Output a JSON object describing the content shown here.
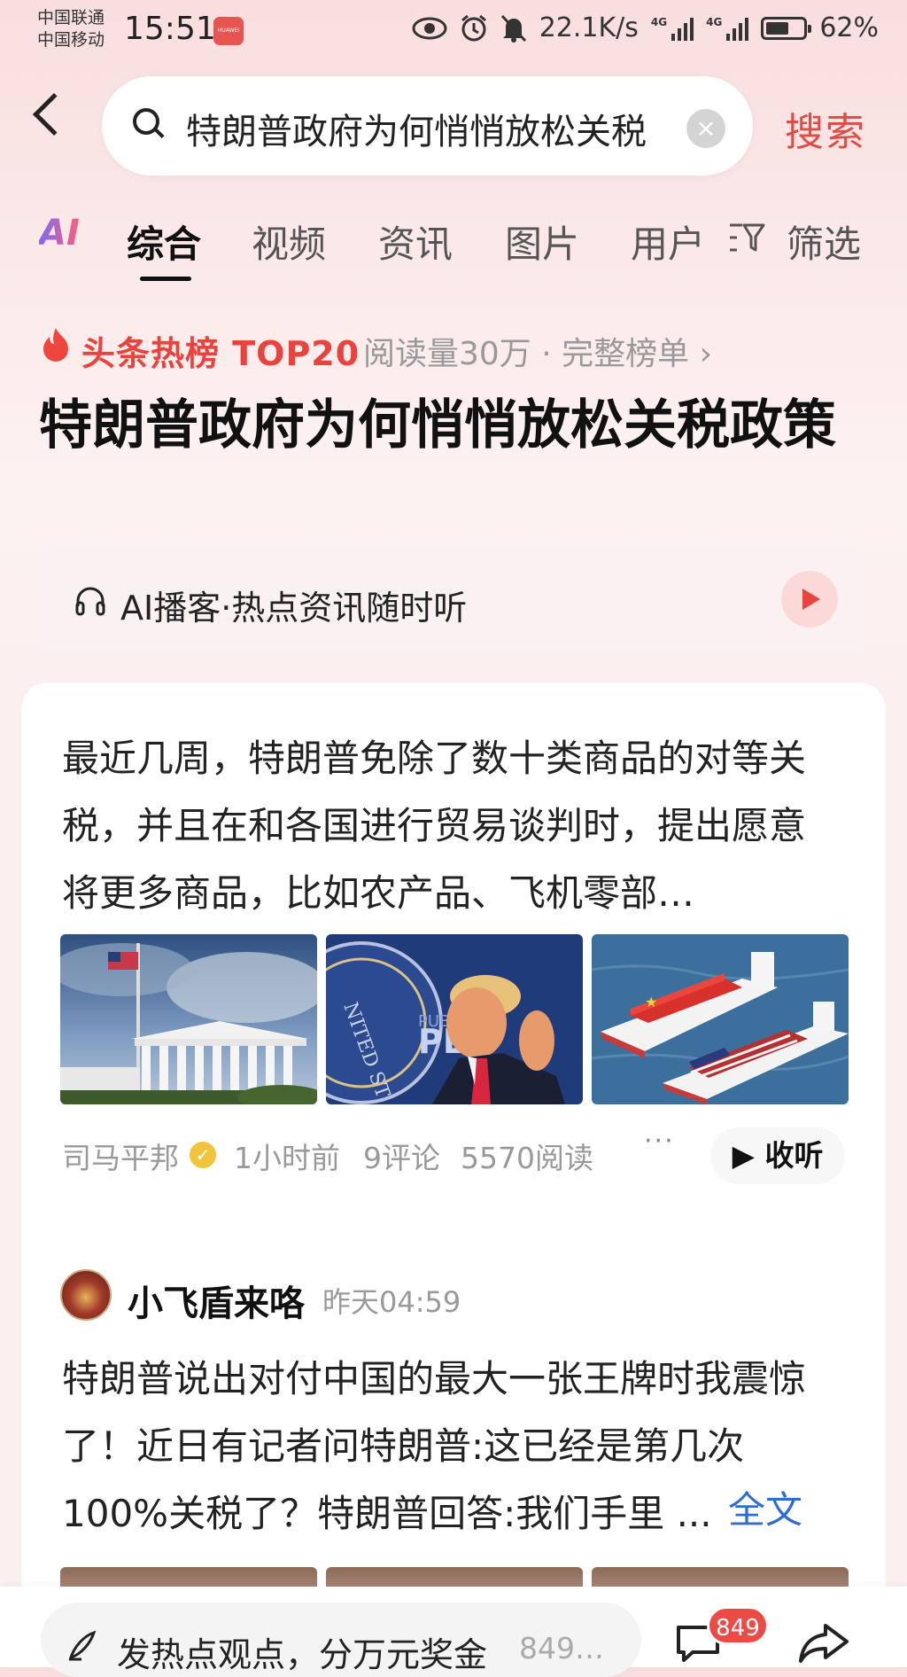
{
  "status_bar": {
    "carrier_1": "中国联通",
    "carrier_2": "中国移动",
    "time": "15:51",
    "app_badge": "HUAWEI",
    "net_speed": "22.1K/s",
    "sig1": "4G",
    "sig2": "4G",
    "battery": "62%",
    "battery_level": 0.62
  },
  "search": {
    "query": "特朗普政府为何悄悄放松关税",
    "button_label": "搜索"
  },
  "tabs": {
    "ai": "AI",
    "items": [
      "综合",
      "视频",
      "资讯",
      "图片",
      "用户"
    ],
    "active": "综合",
    "filter_label": "筛选"
  },
  "hot": {
    "label": "头条热榜 TOP20",
    "meta": "阅读量30万 · 完整榜单 ›",
    "title": "特朗普政府为何悄悄放松关税政策"
  },
  "podcast": {
    "label": "AI播客·热点资讯随时听"
  },
  "article1": {
    "excerpt": "最近几周，特朗普免除了数十类商品的对等关税，并且在和各国进行贸易谈判时，提出愿意将更多商品，比如农产品、飞机零部…",
    "author": "司马平邦",
    "time": "1小时前",
    "comments": "9评论",
    "reads": "5570阅读",
    "more": "···",
    "listen_label": "收听",
    "images": [
      "supreme-court-photo",
      "trump-photo",
      "cargo-ships-illustration"
    ]
  },
  "article2": {
    "author": "小飞盾来咯",
    "time": "昨天04:59",
    "excerpt": "特朗普说出对付中国的最大一张王牌时我震惊了！近日有记者问特朗普:这已经是第几次100%关税了？特朗普回答:我们手里 ...",
    "fulltext_label": "全文"
  },
  "bottom_bar": {
    "comment_placeholder": "发热点观点，分万元奖金",
    "comment_count_inline": "849…",
    "comment_badge": "849"
  },
  "colors": {
    "accent_red": "#e14b45",
    "link_blue": "#2e6cd6"
  }
}
